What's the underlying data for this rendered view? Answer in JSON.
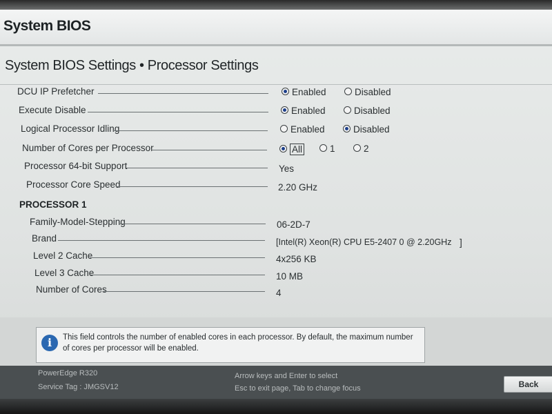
{
  "window": {
    "title": "System BIOS"
  },
  "page": {
    "title": "System BIOS Settings • Processor Settings"
  },
  "settings": [
    {
      "label": "DCU IP Prefetcher",
      "options": [
        "Enabled",
        "Disabled"
      ],
      "selected": "Enabled"
    },
    {
      "label": "Execute Disable",
      "options": [
        "Enabled",
        "Disabled"
      ],
      "selected": "Enabled"
    },
    {
      "label": "Logical Processor Idling",
      "options": [
        "Enabled",
        "Disabled"
      ],
      "selected": "Disabled"
    },
    {
      "label": "Number of Cores per Processor",
      "options": [
        "All",
        "1",
        "2"
      ],
      "selected": "All"
    },
    {
      "label": "Processor 64-bit Support",
      "value": "Yes"
    },
    {
      "label": "Processor Core Speed",
      "value": "2.20 GHz"
    }
  ],
  "processor1": {
    "heading": "PROCESSOR 1",
    "fields": [
      {
        "label": "Family-Model-Stepping",
        "value": "06-2D-7"
      },
      {
        "label": "Brand",
        "value": "[Intel(R) Xeon(R) CPU E5-2407 0 @ 2.20GHz",
        "value_end": "]"
      },
      {
        "label": "Level 2 Cache",
        "value": "4x256 KB"
      },
      {
        "label": "Level 3 Cache",
        "value": "10 MB"
      },
      {
        "label": "Number of Cores",
        "value": "4"
      }
    ]
  },
  "help": {
    "icon": "info-icon",
    "icon_glyph": "i",
    "text": "This field controls the number of enabled cores in each processor. By default, the maximum number of cores per processor will be enabled."
  },
  "footer": {
    "model": "PowerEdge R320",
    "service_tag": "Service Tag : JMGSV12",
    "hint1": "Arrow keys and Enter to select",
    "hint2": "Esc to exit page, Tab to change focus",
    "back_label": "Back"
  },
  "colors": {
    "radio_selected": "#1c3f8a",
    "info_icon": "#2b68b1",
    "footer_bg": "#4a4f51"
  }
}
